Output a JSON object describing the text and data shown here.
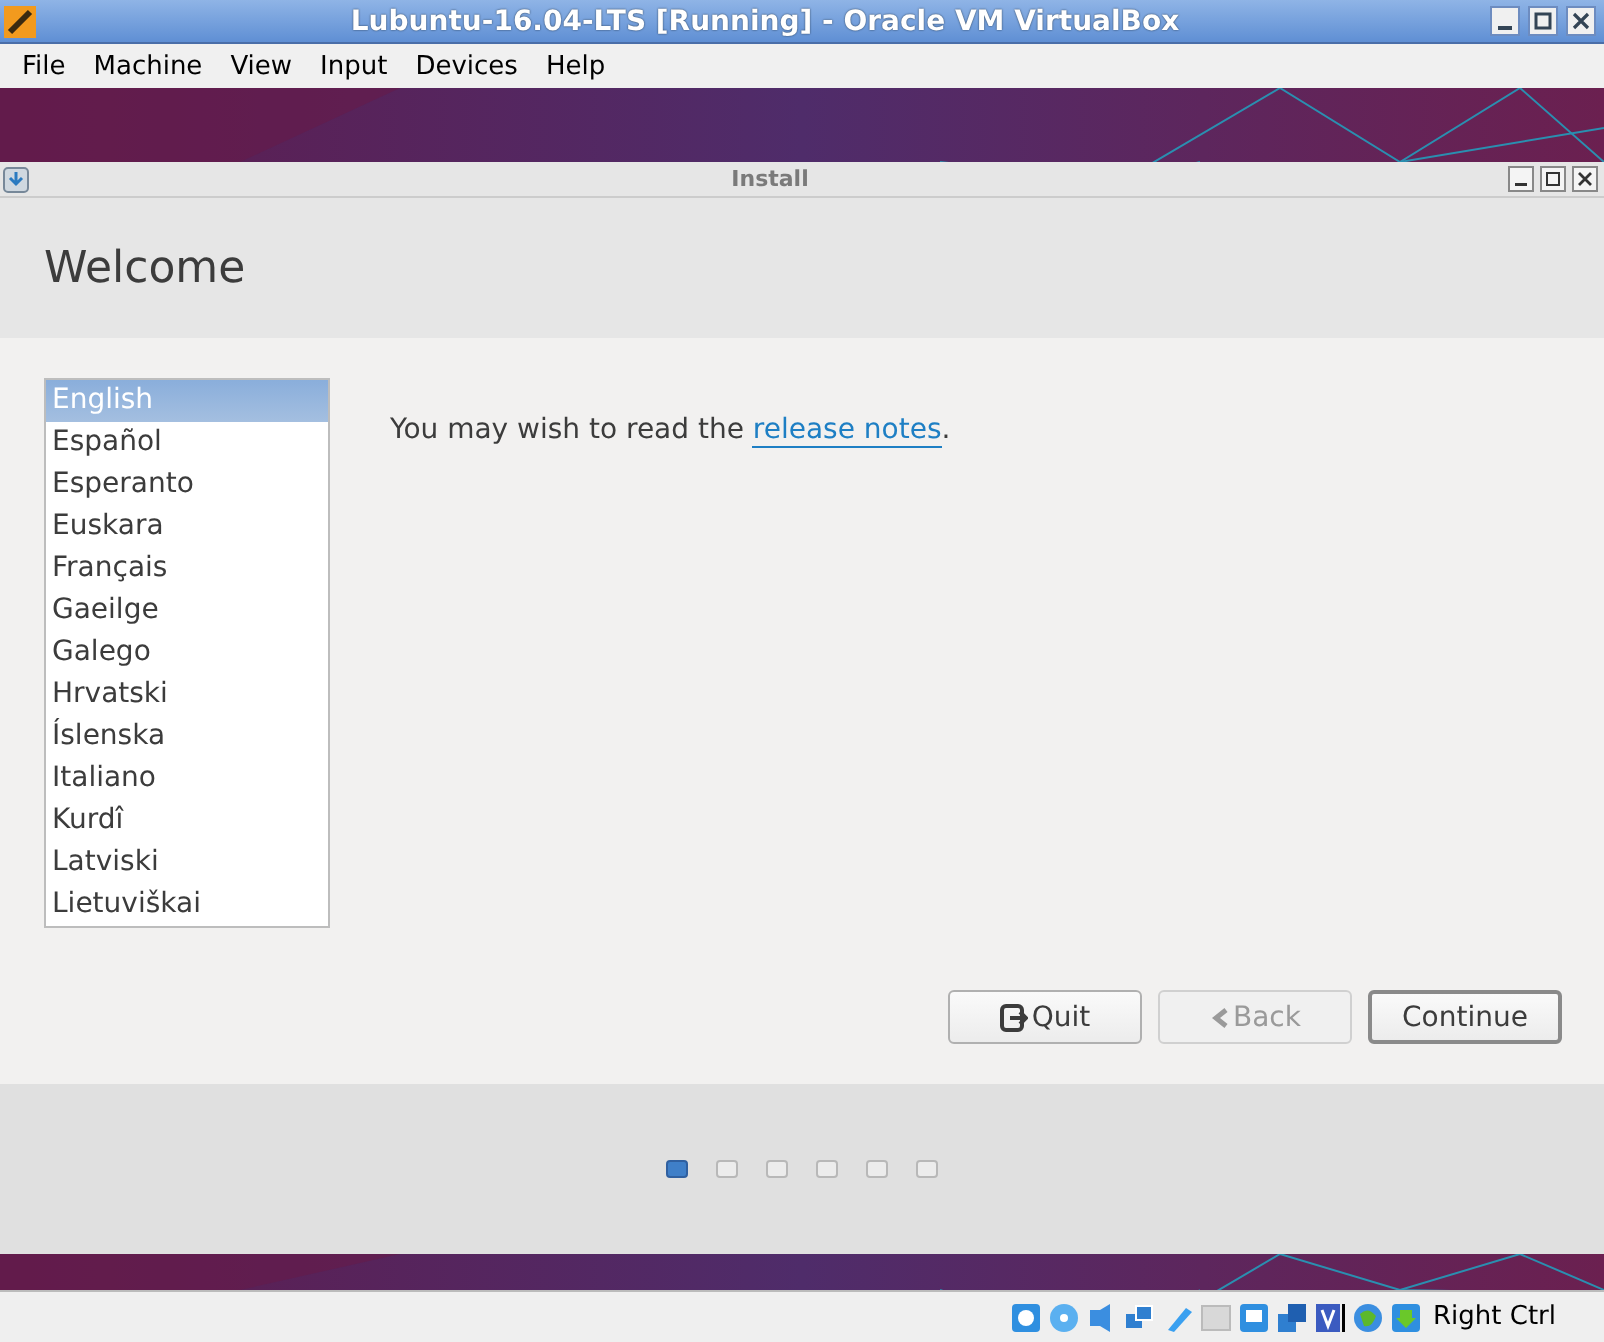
{
  "vm_window": {
    "title": "Lubuntu-16.04-LTS [Running] - Oracle VM VirtualBox"
  },
  "menu": [
    "File",
    "Machine",
    "View",
    "Input",
    "Devices",
    "Help"
  ],
  "installer": {
    "title": "Install",
    "heading": "Welcome",
    "languages": [
      {
        "label": "English",
        "selected": true
      },
      {
        "label": "Español",
        "selected": false
      },
      {
        "label": "Esperanto",
        "selected": false
      },
      {
        "label": "Euskara",
        "selected": false
      },
      {
        "label": "Français",
        "selected": false
      },
      {
        "label": "Gaeilge",
        "selected": false
      },
      {
        "label": "Galego",
        "selected": false
      },
      {
        "label": "Hrvatski",
        "selected": false
      },
      {
        "label": "Íslenska",
        "selected": false
      },
      {
        "label": "Italiano",
        "selected": false
      },
      {
        "label": "Kurdî",
        "selected": false
      },
      {
        "label": "Latviski",
        "selected": false
      },
      {
        "label": "Lietuviškai",
        "selected": false
      }
    ],
    "message": {
      "before": "You may wish to read the ",
      "link": "release notes",
      "after": "."
    },
    "buttons": [
      {
        "label": "Quit",
        "kind": "quit",
        "disabled": false,
        "default": false
      },
      {
        "label": "Back",
        "kind": "back",
        "disabled": true,
        "default": false
      },
      {
        "label": "Continue",
        "kind": "plain",
        "disabled": false,
        "default": true
      }
    ],
    "steps": [
      {
        "selected": true
      },
      {
        "selected": false
      },
      {
        "selected": false
      },
      {
        "selected": false
      },
      {
        "selected": false
      },
      {
        "selected": false
      }
    ]
  },
  "status_bar": {
    "host_key": "Right Ctrl"
  }
}
